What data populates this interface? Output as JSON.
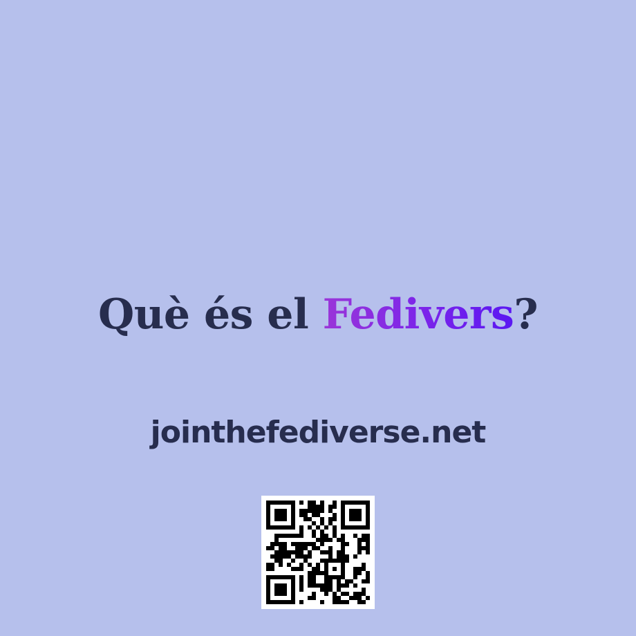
{
  "headline": {
    "prefix": "Què és el ",
    "highlight": "Fedivers",
    "suffix": "?"
  },
  "url": "jointhefediverse.net",
  "colors": {
    "background": "#b6c0ec",
    "text": "#272d4e",
    "accent_start": "#9a36d8",
    "accent_end": "#5a17f2"
  },
  "icons": {
    "qr": "qr-code-icon"
  }
}
